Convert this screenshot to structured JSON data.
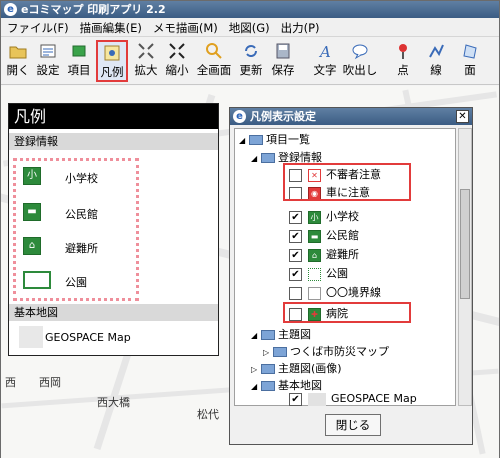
{
  "app": {
    "title": "eコミマップ 印刷アプリ 2.2",
    "icon_letter": "e"
  },
  "menu": [
    "ファイル(F)",
    "描画編集(E)",
    "メモ描画(M)",
    "地図(G)",
    "出力(P)"
  ],
  "toolbar": {
    "open": "開く",
    "settings": "設定",
    "items": "項目",
    "legend": "凡例",
    "zoom_in": "拡大",
    "zoom_out": "縮小",
    "full": "全画面",
    "refresh": "更新",
    "save": "保存",
    "text": "文字",
    "balloon": "吹出し",
    "point": "点",
    "line": "線",
    "area": "面"
  },
  "map": {
    "labels": [
      "西",
      "西岡",
      "西大橋",
      "松代"
    ]
  },
  "legend_panel": {
    "title": "凡例",
    "section_registered": "登録情報",
    "items": [
      {
        "label": "小学校",
        "symbol": "小"
      },
      {
        "label": "公民館",
        "symbol": "▬"
      },
      {
        "label": "避難所",
        "symbol": "⌂"
      },
      {
        "label": "公園",
        "symbol": ""
      }
    ],
    "section_base": "基本地図",
    "base_map": "GEOSPACE Map"
  },
  "dialog": {
    "title": "凡例表示設定",
    "close_glyph": "✕",
    "tree": {
      "root": "項目一覧",
      "registered": "登録情報",
      "items": [
        {
          "label": "不審者注意",
          "checked": false,
          "symbol": "✕",
          "color": "#e23b3b"
        },
        {
          "label": "車に注意",
          "checked": false,
          "symbol": "◉",
          "color": "#e23b3b"
        },
        {
          "label": "小学校",
          "checked": true,
          "symbol": "小",
          "color": "#2d8a3b"
        },
        {
          "label": "公民館",
          "checked": true,
          "symbol": "▬",
          "color": "#2d8a3b"
        },
        {
          "label": "避難所",
          "checked": true,
          "symbol": "⌂",
          "color": "#2d8a3b"
        },
        {
          "label": "公園",
          "checked": true,
          "symbol": "",
          "color": "#2d8a3b"
        },
        {
          "label": "〇〇境界線",
          "checked": false,
          "symbol": "",
          "color": "#777777"
        },
        {
          "label": "病院",
          "checked": false,
          "symbol": "✚",
          "color": "#e23b3b"
        }
      ],
      "theme": "主題図",
      "theme_child": "つくば市防災マップ",
      "theme_image": "主題図(画像)",
      "base": "基本地図",
      "base_child": "GEOSPACE Map"
    },
    "close_button": "閉じる"
  },
  "colors": {
    "highlight": "#e23b3b",
    "title_bar": "#3b5c83",
    "dotted_group": "#ef8f9b"
  }
}
